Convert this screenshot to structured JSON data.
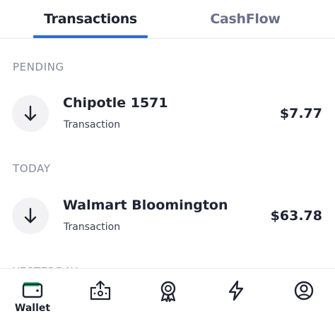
{
  "tabs": [
    {
      "label": "Transactions",
      "active": true
    },
    {
      "label": "CashFlow",
      "active": false
    }
  ],
  "sections": [
    {
      "header": "PENDING",
      "items": [
        {
          "name": "Chipotle 1571",
          "subtitle": "Transaction",
          "amount": "$7.77",
          "icon": "arrow-down-icon"
        }
      ]
    },
    {
      "header": "TODAY",
      "items": [
        {
          "name": "Walmart Bloomington",
          "subtitle": "Transaction",
          "amount": "$63.78",
          "icon": "arrow-down-icon"
        }
      ]
    },
    {
      "header": "YESTERDAY",
      "items": []
    }
  ],
  "bottom_nav": [
    {
      "label": "Wallet",
      "icon": "wallet-icon",
      "active": true
    },
    {
      "label": "",
      "icon": "send-money-icon",
      "active": false
    },
    {
      "label": "",
      "icon": "rewards-badge-icon",
      "active": false
    },
    {
      "label": "",
      "icon": "lightning-icon",
      "active": false
    },
    {
      "label": "",
      "icon": "profile-icon",
      "active": false
    }
  ],
  "colors": {
    "accent": "#2f6bdc",
    "wallet_green": "#2ec27e",
    "text_primary": "#1f2433",
    "text_muted": "#868a9a",
    "tab_inactive": "#6c6f8a"
  }
}
